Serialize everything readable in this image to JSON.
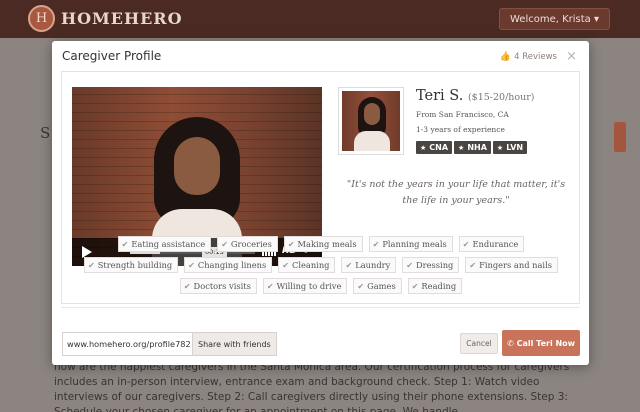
{
  "header": {
    "logo_mark": "H",
    "logo_text": "HOMEHERO",
    "welcome_label": "Welcome, Krista ▾"
  },
  "background": {
    "heading_fragment": "S",
    "paragraph": "how are the happiest caregivers in the Santa Monica area. Our certification process for caregivers includes an in-person interview, entrance exam and background check. Step 1: Watch video interviews of our caregivers. Step 2: Call caregivers directly using their phone extensions. Step 3: Schedule your chosen caregiver for an appointment on this page. We handle"
  },
  "modal": {
    "title": "Caregiver Profile",
    "reviews_label": "4 Reviews",
    "close_label": "×"
  },
  "video": {
    "time_label": "00:13",
    "hd_label": "HD",
    "progress": 0.24
  },
  "profile": {
    "name": "Teri S.",
    "rate": "($15-20/hour)",
    "location": "From San Francisco, CA",
    "experience": "1-3 years of experience",
    "certifications": [
      "CNA",
      "NHA",
      "LVN"
    ],
    "quote": "\"It's not the years in your life that matter, it's the life in your years.\""
  },
  "skills": [
    "Eating assistance",
    "Groceries",
    "Making meals",
    "Planning meals",
    "Endurance",
    "Strength building",
    "Changing linens",
    "Cleaning",
    "Laundry",
    "Dressing",
    "Fingers and nails",
    "Doctors visits",
    "Willing to drive",
    "Games",
    "Reading"
  ],
  "footer": {
    "profile_url": "www.homehero.org/profile782",
    "share_label": "Share with friends",
    "cancel_label": "Cancel",
    "call_label": "Call Teri Now"
  },
  "colors": {
    "accent": "#c8735a",
    "header_bg": "#4a2a22",
    "badge_bg": "#4a4543"
  }
}
